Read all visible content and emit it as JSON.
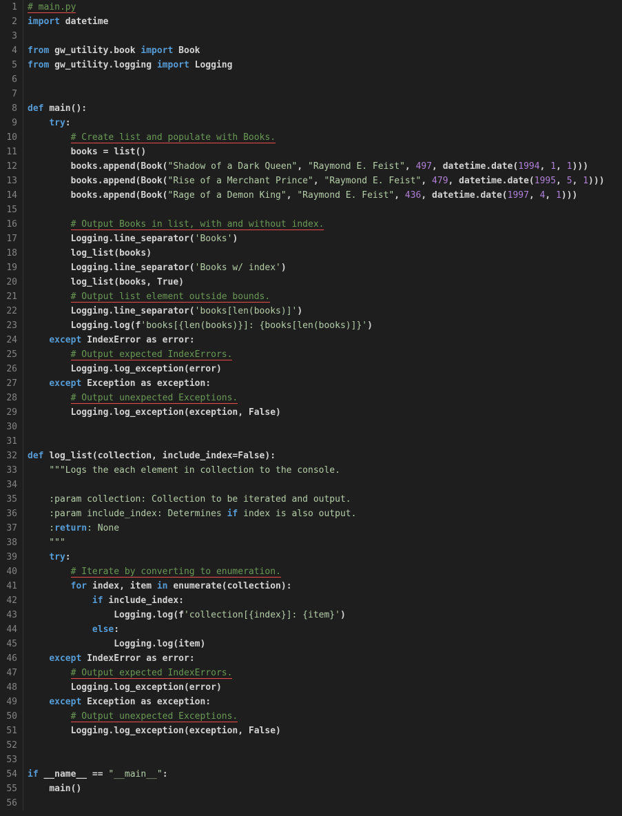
{
  "lines": [
    {
      "n": 1,
      "html": "<span class='cm err'># main.py</span>"
    },
    {
      "n": 2,
      "html": "<span class='kw'>import</span> <span class='plain bold'>datetime</span>"
    },
    {
      "n": 3,
      "html": ""
    },
    {
      "n": 4,
      "html": "<span class='kw'>from</span> <span class='plain bold'>gw_utility.book</span> <span class='kw'>import</span> <span class='plain bold'>Book</span>"
    },
    {
      "n": 5,
      "html": "<span class='kw'>from</span> <span class='plain bold'>gw_utility.logging</span> <span class='kw'>import</span> <span class='plain bold'>Logging</span>"
    },
    {
      "n": 6,
      "html": ""
    },
    {
      "n": 7,
      "html": ""
    },
    {
      "n": 8,
      "html": "<span class='kw'>def</span> <span class='plain bold'>main():</span>"
    },
    {
      "n": 9,
      "html": "    <span class='kw'>try</span><span class='plain bold'>:</span>"
    },
    {
      "n": 10,
      "html": "        <span class='cm err'># Create list and populate with Books.</span>"
    },
    {
      "n": 11,
      "html": "        <span class='plain bold'>books = list()</span>"
    },
    {
      "n": 12,
      "html": "        <span class='plain bold'>books.append(Book(</span><span class='str'>\"Shadow of a Dark Queen\"</span><span class='plain bold'>, </span><span class='str'>\"Raymond E. Feist\"</span><span class='plain bold'>, </span><span class='lit'>497</span><span class='plain bold'>, datetime.date(</span><span class='lit'>1994</span><span class='plain bold'>, </span><span class='lit'>1</span><span class='plain bold'>, </span><span class='lit'>1</span><span class='plain bold'>)))</span>"
    },
    {
      "n": 13,
      "html": "        <span class='plain bold'>books.append(Book(</span><span class='str'>\"Rise of a Merchant Prince\"</span><span class='plain bold'>, </span><span class='str'>\"Raymond E. Feist\"</span><span class='plain bold'>, </span><span class='lit'>479</span><span class='plain bold'>, datetime.date(</span><span class='lit'>1995</span><span class='plain bold'>, </span><span class='lit'>5</span><span class='plain bold'>, </span><span class='lit'>1</span><span class='plain bold'>)))</span>"
    },
    {
      "n": 14,
      "html": "        <span class='plain bold'>books.append(Book(</span><span class='str'>\"Rage of a Demon King\"</span><span class='plain bold'>, </span><span class='str'>\"Raymond E. Feist\"</span><span class='plain bold'>, </span><span class='lit'>436</span><span class='plain bold'>, datetime.date(</span><span class='lit'>1997</span><span class='plain bold'>, </span><span class='lit'>4</span><span class='plain bold'>, </span><span class='lit'>1</span><span class='plain bold'>)))</span>"
    },
    {
      "n": 15,
      "html": ""
    },
    {
      "n": 16,
      "html": "        <span class='cm err'># Output Books in list, with and without index.</span>"
    },
    {
      "n": 17,
      "html": "        <span class='plain bold'>Logging.line_separator(</span><span class='str'>'Books'</span><span class='plain bold'>)</span>"
    },
    {
      "n": 18,
      "html": "        <span class='plain bold'>log_list(books)</span>"
    },
    {
      "n": 19,
      "html": "        <span class='plain bold'>Logging.line_separator(</span><span class='str'>'Books w/ index'</span><span class='plain bold'>)</span>"
    },
    {
      "n": 20,
      "html": "        <span class='plain bold'>log_list(books, True)</span>"
    },
    {
      "n": 21,
      "html": "        <span class='cm err'># Output list element outside bounds.</span>"
    },
    {
      "n": 22,
      "html": "        <span class='plain bold'>Logging.line_separator(</span><span class='str'>'books[len(books)]'</span><span class='plain bold'>)</span>"
    },
    {
      "n": 23,
      "html": "        <span class='plain bold'>Logging.log(f</span><span class='str'>'books[{len(books)}]: {books[len(books)]}'</span><span class='plain bold'>)</span>"
    },
    {
      "n": 24,
      "html": "    <span class='kw'>except</span> <span class='plain bold'>IndexError as error:</span>"
    },
    {
      "n": 25,
      "html": "        <span class='cm err'># Output expected IndexErrors.</span>"
    },
    {
      "n": 26,
      "html": "        <span class='plain bold'>Logging.log_exception(error)</span>"
    },
    {
      "n": 27,
      "html": "    <span class='kw'>except</span> <span class='plain bold'>Exception as exception:</span>"
    },
    {
      "n": 28,
      "html": "        <span class='cm err'># Output unexpected Exceptions.</span>"
    },
    {
      "n": 29,
      "html": "        <span class='plain bold'>Logging.log_exception(exception, False)</span>"
    },
    {
      "n": 30,
      "html": ""
    },
    {
      "n": 31,
      "html": ""
    },
    {
      "n": 32,
      "html": "<span class='kw'>def</span> <span class='plain bold'>log_list(collection, include_index=False):</span>"
    },
    {
      "n": 33,
      "html": "    <span class='str'>\"\"\"Logs the each element in collection to the console.</span>"
    },
    {
      "n": 34,
      "html": ""
    },
    {
      "n": 35,
      "html": "<span class='str'>    :param collection: Collection to be iterated and output.</span>"
    },
    {
      "n": 36,
      "html": "<span class='str'>    :param include_index: Determines </span><span class='kw'>if</span><span class='str'> index is also output.</span>"
    },
    {
      "n": 37,
      "html": "<span class='str'>    :</span><span class='kw'>return</span><span class='str'>: None</span>"
    },
    {
      "n": 38,
      "html": "<span class='str'>    \"\"\"</span>"
    },
    {
      "n": 39,
      "html": "    <span class='kw'>try</span><span class='plain bold'>:</span>"
    },
    {
      "n": 40,
      "html": "        <span class='cm err'># Iterate by converting to enumeration.</span>"
    },
    {
      "n": 41,
      "html": "        <span class='kw'>for</span> <span class='plain bold'>index, item</span> <span class='kw'>in</span> <span class='plain bold'>enumerate(collection):</span>"
    },
    {
      "n": 42,
      "html": "            <span class='kw'>if</span> <span class='plain bold'>include_index:</span>"
    },
    {
      "n": 43,
      "html": "                <span class='plain bold'>Logging.log(f</span><span class='str'>'collection[{index}]: {item}'</span><span class='plain bold'>)</span>"
    },
    {
      "n": 44,
      "html": "            <span class='kw'>else</span><span class='plain bold'>:</span>"
    },
    {
      "n": 45,
      "html": "                <span class='plain bold'>Logging.log(item)</span>"
    },
    {
      "n": 46,
      "html": "    <span class='kw'>except</span> <span class='plain bold'>IndexError as error:</span>"
    },
    {
      "n": 47,
      "html": "        <span class='cm err'># Output expected IndexErrors.</span>"
    },
    {
      "n": 48,
      "html": "        <span class='plain bold'>Logging.log_exception(error)</span>"
    },
    {
      "n": 49,
      "html": "    <span class='kw'>except</span> <span class='plain bold'>Exception as exception:</span>"
    },
    {
      "n": 50,
      "html": "        <span class='cm err'># Output unexpected Exceptions.</span>"
    },
    {
      "n": 51,
      "html": "        <span class='plain bold'>Logging.log_exception(exception, False)</span>"
    },
    {
      "n": 52,
      "html": ""
    },
    {
      "n": 53,
      "html": ""
    },
    {
      "n": 54,
      "html": "<span class='kw'>if</span> <span class='plain bold'>__name__ == </span><span class='str'>\"__main__\"</span><span class='plain bold'>:</span>"
    },
    {
      "n": 55,
      "html": "    <span class='plain bold'>main()</span>"
    },
    {
      "n": 56,
      "html": ""
    }
  ]
}
